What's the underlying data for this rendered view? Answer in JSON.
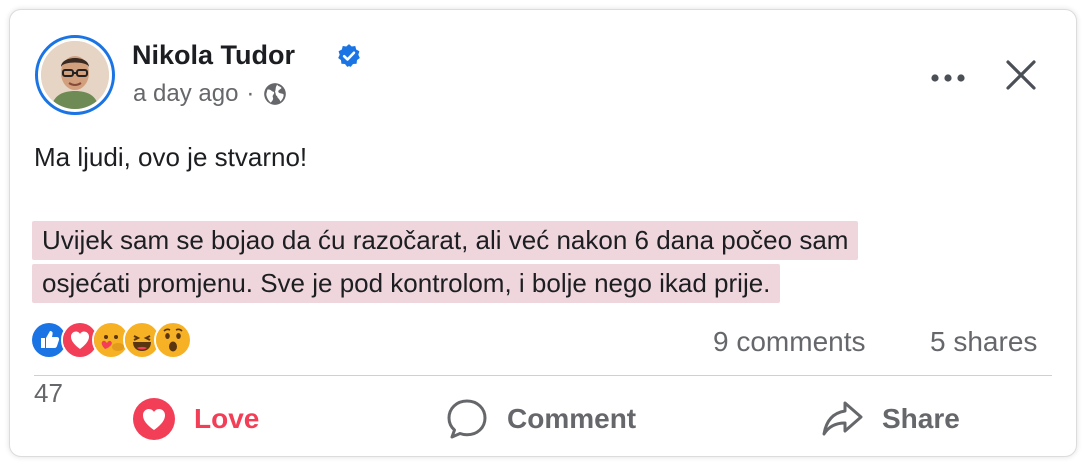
{
  "post": {
    "author": "Nikola Tudor",
    "time": "a day ago",
    "separator": "·",
    "text_line1": "Ma ljudi, ovo je stvarno!",
    "highlight_line1": "Uvijek sam se bojao da ću razočarat, ali već nakon 6 dana počeo sam",
    "highlight_line2": "osjećati promjenu. Sve je pod kontrolom, i bolje nego ikad prije.",
    "highlight_color": "#efd6dd"
  },
  "stats": {
    "reaction_count": "47",
    "comments": "9 comments",
    "shares": "5 shares",
    "reaction_icons": [
      "like-icon",
      "love-icon",
      "care-icon",
      "haha-icon",
      "wow-icon"
    ]
  },
  "actions": {
    "love": "Love",
    "comment": "Comment",
    "share": "Share"
  },
  "colors": {
    "accent_blue": "#1b74e4",
    "love_red": "#f33e58",
    "muted_text": "#65676b"
  }
}
